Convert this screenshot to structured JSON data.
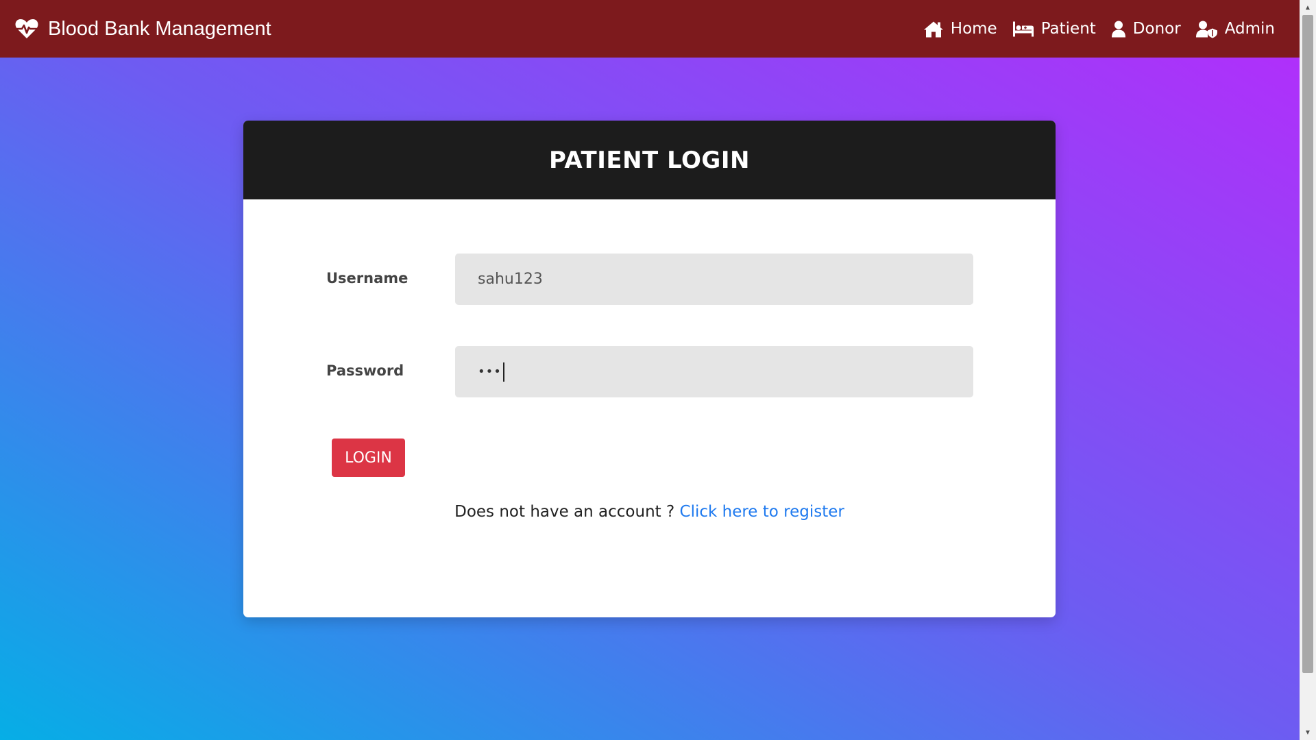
{
  "navbar": {
    "brand": "Blood Bank Management",
    "brand_icon": "heartbeat-icon",
    "links": [
      {
        "label": "Home",
        "icon": "home-icon"
      },
      {
        "label": "Patient",
        "icon": "hospital-bed-icon"
      },
      {
        "label": "Donor",
        "icon": "user-icon"
      },
      {
        "label": "Admin",
        "icon": "user-shield-icon"
      }
    ]
  },
  "card": {
    "title": "PATIENT LOGIN",
    "username_label": "Username",
    "username_value": "sahu123",
    "password_label": "Password",
    "password_value": "•••",
    "login_label": "LOGIN",
    "register_prompt": "Does not have an account ?",
    "register_link": "Click here to register"
  },
  "colors": {
    "navbar": "#7d1a1d",
    "card_header": "#1c1c1c",
    "login_button": "#dc3545",
    "link": "#1f7aef",
    "gradient_start": "#06aee6",
    "gradient_end": "#b52cfb"
  },
  "scrollbar": {
    "up_glyph": "▲",
    "down_glyph": "▼"
  }
}
